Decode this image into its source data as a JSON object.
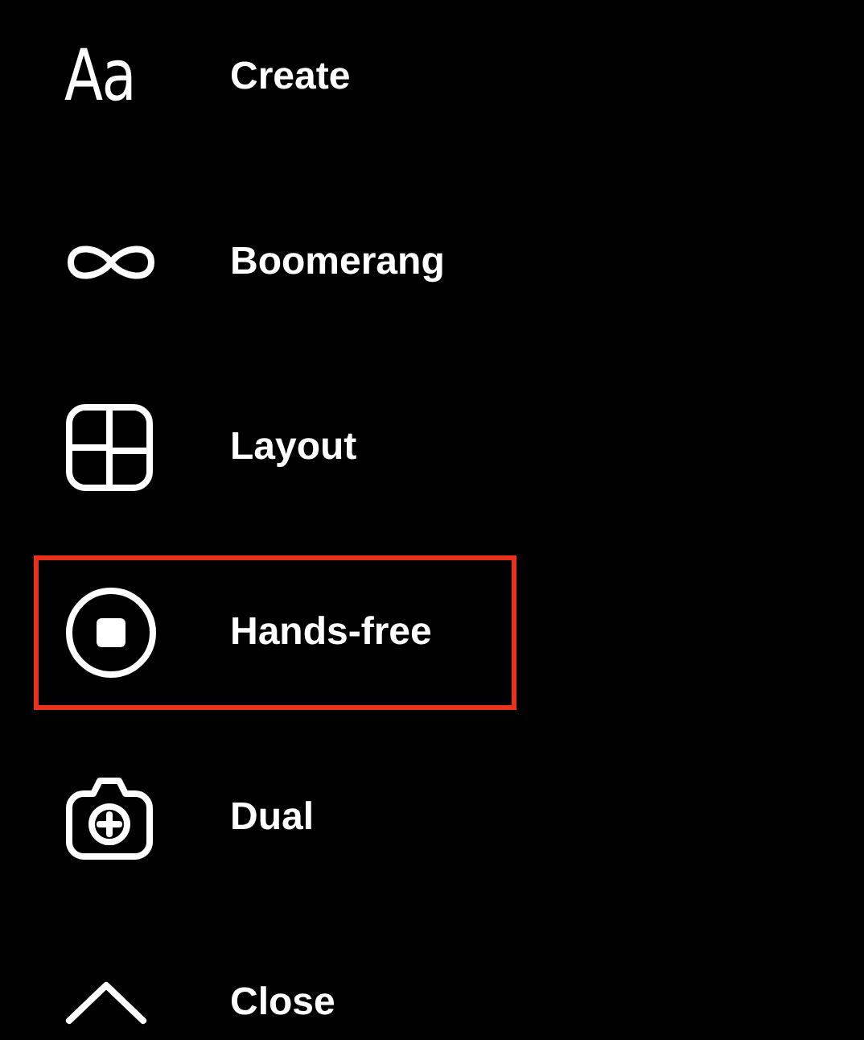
{
  "menu": [
    {
      "kind": "text",
      "icon_text": "Aa",
      "label": "Create",
      "selected": false
    },
    {
      "kind": "infinity",
      "label": "Boomerang",
      "selected": false
    },
    {
      "kind": "layout",
      "label": "Layout",
      "selected": false
    },
    {
      "kind": "record",
      "label": "Hands-free",
      "selected": true
    },
    {
      "kind": "camera",
      "label": "Dual",
      "selected": false
    },
    {
      "kind": "chevron",
      "label": "Close",
      "selected": false
    }
  ]
}
